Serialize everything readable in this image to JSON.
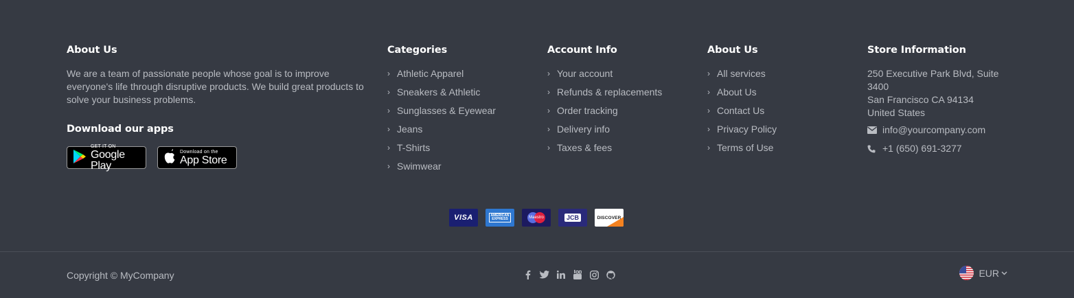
{
  "about": {
    "title": "About Us",
    "text": "We are a team of passionate people whose goal is to improve everyone's life through disruptive products. We build great products to solve your business problems.",
    "apps_title": "Download our apps",
    "google_small": "GET IT ON",
    "google_big": "Google Play",
    "apple_small": "Download on the",
    "apple_big": "App Store"
  },
  "categories": {
    "title": "Categories",
    "items": [
      "Athletic Apparel",
      "Sneakers & Athletic",
      "Sunglasses & Eyewear",
      "Jeans",
      "T-Shirts",
      "Swimwear"
    ]
  },
  "account": {
    "title": "Account Info",
    "items": [
      "Your account",
      "Refunds & replacements",
      "Order tracking",
      "Delivery info",
      "Taxes & fees"
    ]
  },
  "about2": {
    "title": "About Us",
    "items": [
      "All services",
      "About Us",
      "Contact Us",
      "Privacy Policy",
      "Terms of Use"
    ]
  },
  "store": {
    "title": "Store Information",
    "address_line1": "250 Executive Park Blvd, Suite",
    "address_line2": "3400",
    "address_line3": "San Francisco CA 94134",
    "address_line4": "United States",
    "email": "info@yourcompany.com",
    "phone": "+1 (650) 691-3277"
  },
  "payments": {
    "visa": "VISA",
    "amex": "AMERICAN EXPRESS",
    "maestro": "Maestro",
    "jcb": "JCB",
    "discover": "DISCOVER"
  },
  "bottom": {
    "copyright": "Copyright © MyCompany",
    "currency": "EUR",
    "social_icons": [
      "facebook-icon",
      "twitter-icon",
      "linkedin-icon",
      "youtube-icon",
      "instagram-icon",
      "github-icon"
    ]
  },
  "colors": {
    "background": "#363a43",
    "heading": "#ffffff",
    "text": "#b9bcc2"
  }
}
